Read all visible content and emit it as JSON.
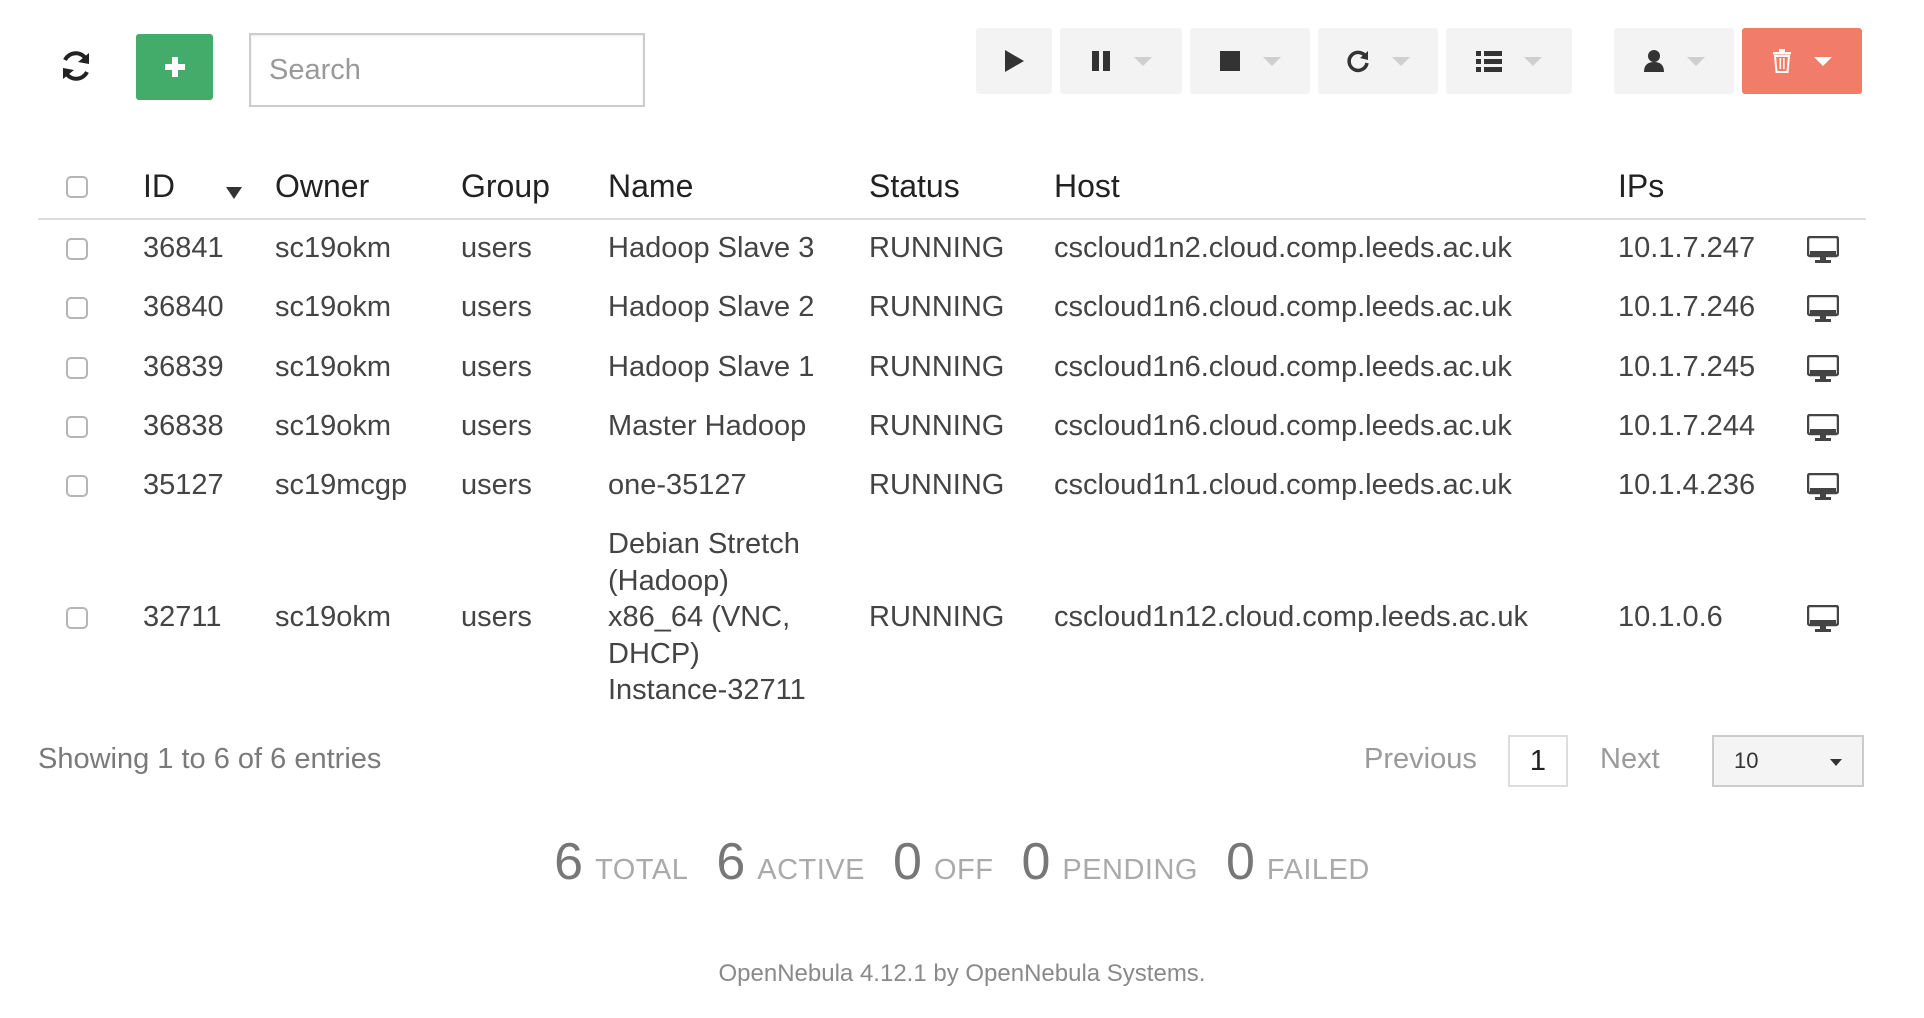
{
  "search": {
    "placeholder": "Search"
  },
  "table": {
    "headers": {
      "id": "ID",
      "owner": "Owner",
      "group": "Group",
      "name": "Name",
      "status": "Status",
      "host": "Host",
      "ips": "IPs"
    },
    "rows": [
      {
        "id": "36841",
        "owner": "sc19okm",
        "group": "users",
        "name": "Hadoop Slave 3",
        "status": "RUNNING",
        "host": "cscloud1n2.cloud.comp.leeds.ac.uk",
        "ip": "10.1.7.247"
      },
      {
        "id": "36840",
        "owner": "sc19okm",
        "group": "users",
        "name": "Hadoop Slave 2",
        "status": "RUNNING",
        "host": "cscloud1n6.cloud.comp.leeds.ac.uk",
        "ip": "10.1.7.246"
      },
      {
        "id": "36839",
        "owner": "sc19okm",
        "group": "users",
        "name": "Hadoop Slave 1",
        "status": "RUNNING",
        "host": "cscloud1n6.cloud.comp.leeds.ac.uk",
        "ip": "10.1.7.245"
      },
      {
        "id": "36838",
        "owner": "sc19okm",
        "group": "users",
        "name": "Master Hadoop",
        "status": "RUNNING",
        "host": "cscloud1n6.cloud.comp.leeds.ac.uk",
        "ip": "10.1.7.244"
      },
      {
        "id": "35127",
        "owner": "sc19mcgp",
        "group": "users",
        "name": "one-35127",
        "status": "RUNNING",
        "host": "cscloud1n1.cloud.comp.leeds.ac.uk",
        "ip": "10.1.4.236"
      },
      {
        "id": "32711",
        "owner": "sc19okm",
        "group": "users",
        "name_lines": [
          "Debian Stretch",
          "(Hadoop)",
          "x86_64 (VNC,",
          "DHCP)",
          "Instance-32711"
        ],
        "status": "RUNNING",
        "host": "cscloud1n12.cloud.comp.leeds.ac.uk",
        "ip": "10.1.0.6"
      }
    ]
  },
  "pagination": {
    "info": "Showing 1 to 6 of 6 entries",
    "previous": "Previous",
    "current": "1",
    "next": "Next",
    "page_length": "10"
  },
  "summary": [
    {
      "value": "6",
      "label": "TOTAL"
    },
    {
      "value": "6",
      "label": "ACTIVE"
    },
    {
      "value": "0",
      "label": "OFF"
    },
    {
      "value": "0",
      "label": "PENDING"
    },
    {
      "value": "0",
      "label": "FAILED"
    }
  ],
  "footer": {
    "credit": "OpenNebula 4.12.1 by OpenNebula Systems."
  },
  "icons": {
    "toolbar": [
      "refresh-icon",
      "plus-icon",
      "play-icon",
      "pause-icon",
      "stop-icon",
      "reboot-icon",
      "list-icon",
      "user-icon",
      "trash-icon"
    ],
    "row_action": "monitor-icon"
  },
  "colors": {
    "create_button": "#43ac6a",
    "delete_button": "#f17c6a",
    "grey_button": "#f3f3f3"
  }
}
